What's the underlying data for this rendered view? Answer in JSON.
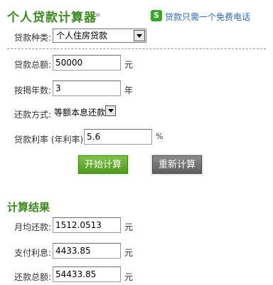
{
  "header": {
    "title": "个人贷款计算器",
    "title_arrow": "»",
    "phone_icon_glyph": "S",
    "phone_icon_name": "phone-icon",
    "phone_text": "贷款只需一个免费电话"
  },
  "form": {
    "loan_type": {
      "label": "贷款种类:",
      "value": "个人住房贷款"
    },
    "amount": {
      "label": "贷款总额:",
      "value": "50000",
      "unit": "元"
    },
    "years": {
      "label": "按揭年数:",
      "value": "3",
      "unit": "年"
    },
    "method": {
      "label": "还款方式:",
      "value": "等额本息还款"
    },
    "rate": {
      "label": "贷款利率 (年利率):",
      "value": "5.6",
      "unit": "%"
    }
  },
  "buttons": {
    "calculate": "开始计算",
    "reset": "重新计算"
  },
  "results": {
    "title": "计算结果",
    "monthly": {
      "label": "月均还款:",
      "value": "1512.0513",
      "unit": "元"
    },
    "interest": {
      "label": "支付利息:",
      "value": "4433.85",
      "unit": "元"
    },
    "total": {
      "label": "还款总额:",
      "value": "54433.85",
      "unit": "元"
    }
  },
  "colors": {
    "accent_green": "#3a8a1e",
    "link_blue": "#2a6bb8"
  }
}
